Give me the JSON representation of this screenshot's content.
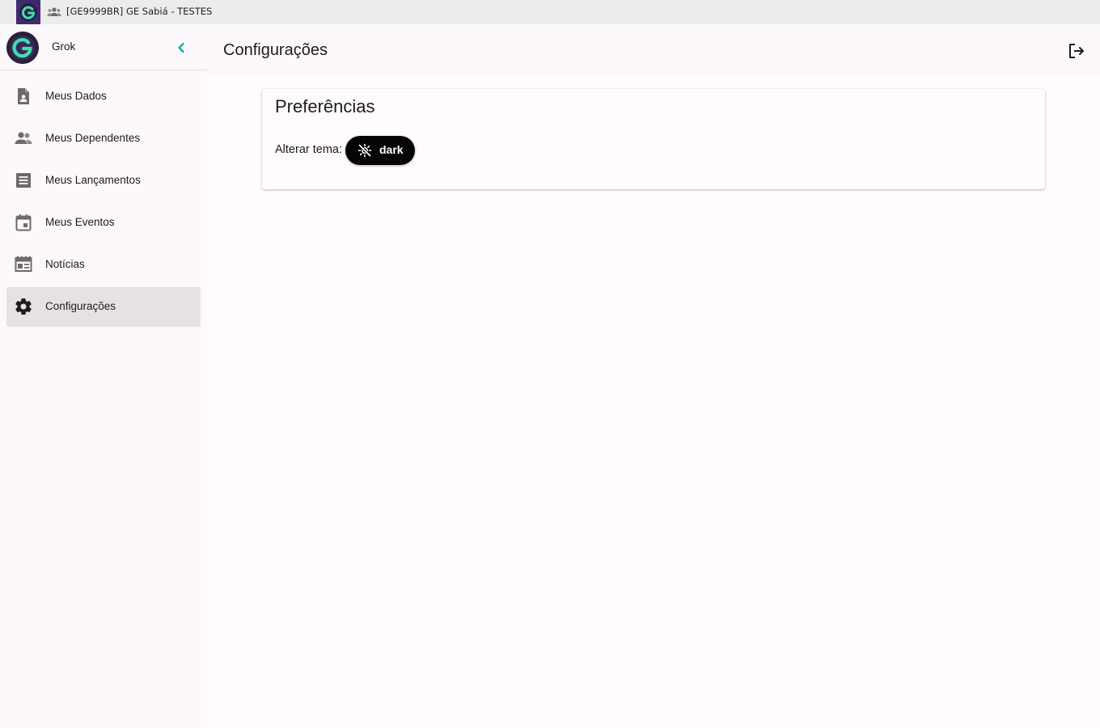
{
  "topbar": {
    "org_name": "[GE9999BR] GE Sabiá - TESTES",
    "logo_icon": "app-logo-icon",
    "group_icon": "group-icon"
  },
  "sidebar": {
    "user_name": "Grok",
    "collapse_icon": "chevron-left-icon",
    "items": [
      {
        "label": "Meus Dados",
        "icon": "person-document-icon",
        "active": false
      },
      {
        "label": "Meus Dependentes",
        "icon": "people-icon",
        "active": false
      },
      {
        "label": "Meus Lançamentos",
        "icon": "list-icon",
        "active": false
      },
      {
        "label": "Meus Eventos",
        "icon": "calendar-icon",
        "active": false
      },
      {
        "label": "Notícias",
        "icon": "newspaper-icon",
        "active": false
      },
      {
        "label": "Configurações",
        "icon": "gear-icon",
        "active": true
      }
    ]
  },
  "header": {
    "title": "Configurações",
    "logout_icon": "logout-icon"
  },
  "preferences": {
    "title": "Preferências",
    "theme_label": "Alterar tema:",
    "theme_button": "dark",
    "theme_icon": "brightness-off-icon"
  },
  "colors": {
    "accent": "#00a3a3",
    "active_item_bg": "#e7e1e5",
    "theme_button_bg": "#050505"
  }
}
